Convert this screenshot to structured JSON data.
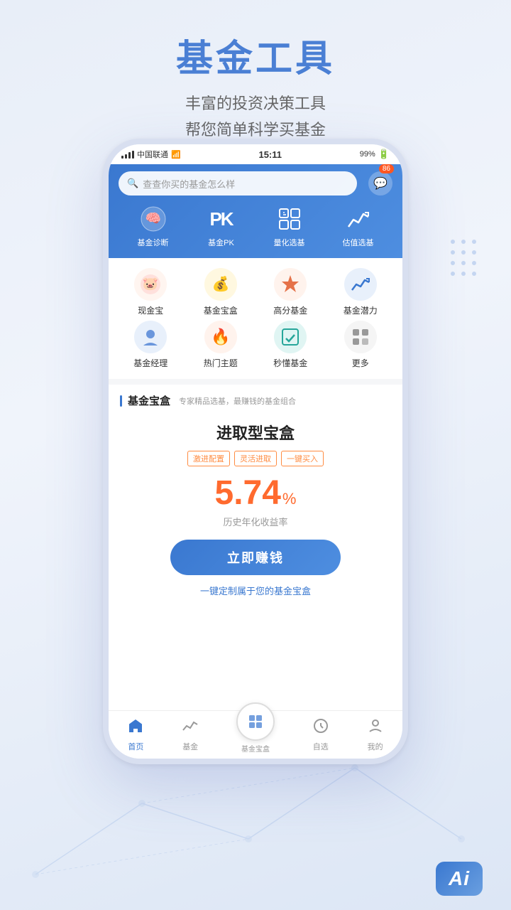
{
  "header": {
    "title": "基金工具",
    "subtitle_line1": "丰富的投资决策工具",
    "subtitle_line2": "帮您简单科学买基金"
  },
  "phone": {
    "status_bar": {
      "carrier": "中国联通",
      "time": "15:11",
      "battery": "99%"
    },
    "search": {
      "placeholder": "查查你买的基金怎么样",
      "message_count": "86"
    },
    "tools": [
      {
        "icon": "🧠",
        "label": "基金诊断"
      },
      {
        "icon": "PK",
        "label": "基金PK"
      },
      {
        "icon": "📊",
        "label": "量化选基"
      },
      {
        "icon": "📈",
        "label": "估值选基"
      }
    ],
    "grid_row1": [
      {
        "label": "现金宝",
        "color": "#ff6b6b",
        "bg": "#fff1f1"
      },
      {
        "label": "基金宝盒",
        "color": "#f0a500",
        "bg": "#fff8e1"
      },
      {
        "label": "高分基金",
        "color": "#e05a2b",
        "bg": "#fff3ed"
      },
      {
        "label": "基金潜力",
        "color": "#3a78d0",
        "bg": "#e8f0fb"
      }
    ],
    "grid_row2": [
      {
        "label": "基金经理",
        "color": "#4a7fd4",
        "bg": "#e8f0fb"
      },
      {
        "label": "热门主题",
        "color": "#ff5722",
        "bg": "#fff3ed"
      },
      {
        "label": "秒懂基金",
        "color": "#26a69a",
        "bg": "#e0f5f3"
      },
      {
        "label": "更多",
        "color": "#666",
        "bg": "#f5f5f5"
      }
    ],
    "fund_box": {
      "section_label": "基金宝盒",
      "section_desc": "专家精品选基，最赚钱的基金组合",
      "card_title": "进取型宝盒",
      "tags": [
        "激进配置",
        "灵活进取",
        "一键买入"
      ],
      "rate": "5.74",
      "rate_unit": "%",
      "rate_label": "历史年化收益率",
      "earn_btn": "立即赚钱",
      "customize_link": "一键定制属于您的基金宝盒"
    },
    "bottom_nav": [
      {
        "icon": "🏠",
        "label": "首页",
        "active": true
      },
      {
        "icon": "📉",
        "label": "基金",
        "active": false
      },
      {
        "icon": "💼",
        "label": "基金宝盒",
        "active": false,
        "center": true
      },
      {
        "icon": "⭐",
        "label": "自选",
        "active": false
      },
      {
        "icon": "👤",
        "label": "我的",
        "active": false
      }
    ]
  },
  "ai_badge": "Ai"
}
